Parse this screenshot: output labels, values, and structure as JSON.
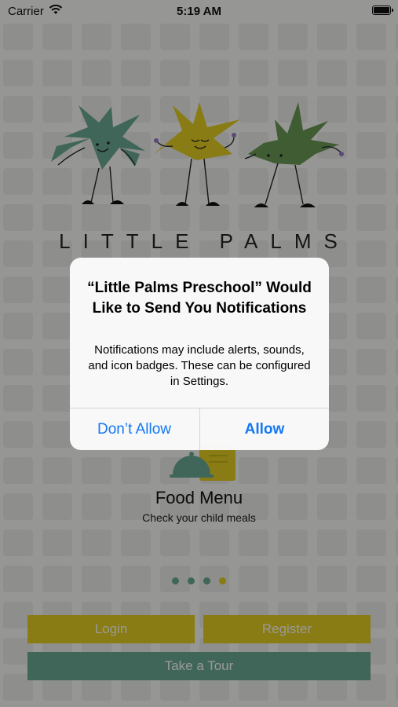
{
  "status_bar": {
    "carrier": "Carrier",
    "time": "5:19 AM"
  },
  "brand": {
    "title": "LITTLE PALMS"
  },
  "slide": {
    "title": "Food Menu",
    "subtitle": "Check your child meals",
    "page_count": 4,
    "active_page": 4
  },
  "buttons": {
    "login": "Login",
    "register": "Register",
    "tour": "Take a Tour"
  },
  "alert": {
    "title": "“Little Palms Preschool” Would Like to Send You Notifications",
    "message": "Notifications may include alerts, sounds, and icon badges. These can be configured in Settings.",
    "deny_label": "Don’t Allow",
    "allow_label": "Allow"
  },
  "colors": {
    "yellow": "#e5cf22",
    "teal": "#6bab95",
    "green": "#6b9a56",
    "link_blue": "#1478f4"
  },
  "icons": [
    "wifi-icon",
    "battery-icon",
    "food-cloche-icon",
    "palm-mascot-icon"
  ]
}
